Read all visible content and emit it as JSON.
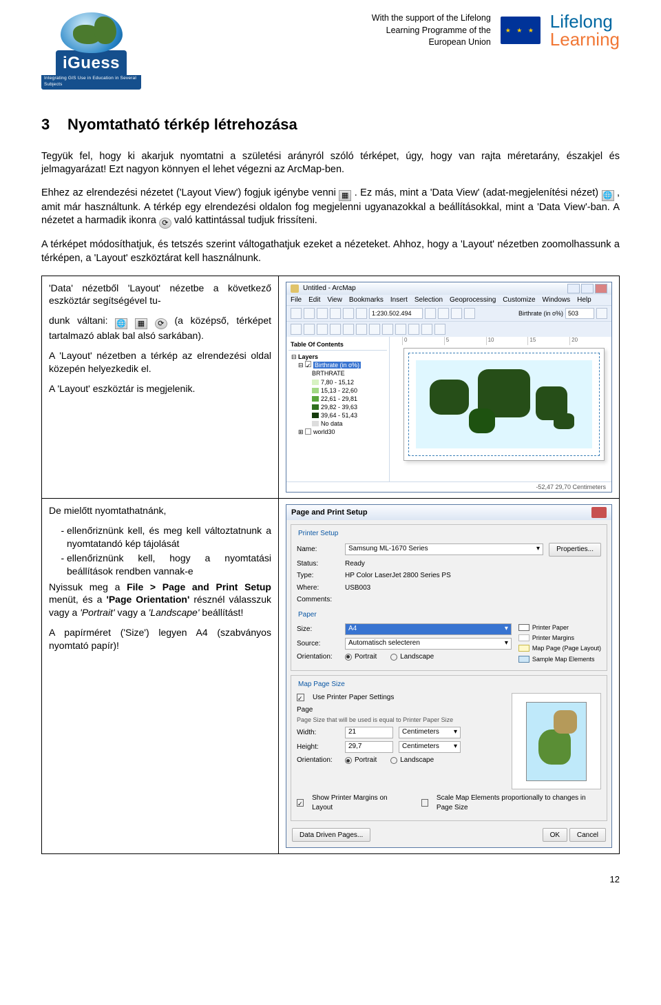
{
  "header": {
    "brand": "iGuess",
    "brand_tagline": "Integrating GIS Use in Education in Several Subjects",
    "support_line1": "With the support of the Lifelong",
    "support_line2": "Learning Programme of the",
    "support_line3": "European Union",
    "eu_stars": "★",
    "ll_lifelong": "Lifelong",
    "ll_learning": "Learning"
  },
  "h1_num": "3",
  "h1_text": "Nyomtatható térkép létrehozása",
  "p1": "Tegyük fel, hogy ki akarjuk nyomtatni a születési arányról szóló térképet, úgy, hogy van rajta méretarány, északjel és jelmagyarázat! Ezt nagyon könnyen el lehet végezni az ArcMap-ben.",
  "p2a": "Ehhez az elrendezési nézetet ('Layout View') fogjuk igénybe venni ",
  "p2b": ". Ez más, mint a 'Data View' (adat-megjelenítési nézet) ",
  "p2c": ", amit már használtunk. A térkép egy elrendezési oldalon fog megjelenni ugyanazokkal a beállításokkal, mint a 'Data View'-ban. A nézetet a harmadik ikonra ",
  "p2d": " való kattintással tudjuk frissíteni.",
  "p3": "A térképet módosíthatjuk, és tetszés szerint váltogathatjuk ezeket a nézeteket. Ahhoz, hogy a 'Layout' nézetben zoomolhassunk a térképen, a 'Layout' eszköztárat kell használnunk.",
  "cell1_a": "'Data' nézetből 'Layout' nézetbe a következő eszköztár segítségével tu-",
  "cell1_b": "dunk váltani: ",
  "cell1_c": " (a középső, térképet tartalmazó ablak bal alsó sarkában).",
  "cell1_d": "A 'Layout' nézetben a térkép az elrendezési oldal közepén helyezkedik el.",
  "cell1_e": "A 'Layout' eszköztár is megjelenik.",
  "cell2_a": "De mielőtt nyomtathatnánk,",
  "cell2_li1": "ellenőriznünk kell, és meg kell változtatnunk a nyomtatandó kép tájolását",
  "cell2_li2": "ellenőriznünk kell, hogy a nyomtatási beállítások rendben vannak-e",
  "cell2_b_pre": "Nyissuk meg a ",
  "cell2_b_bold1": "File > Page and Print Setup",
  "cell2_b_mid": " menüt, és a ",
  "cell2_b_bold2": "'Page Orientation'",
  "cell2_b_post": " résznél válasszuk vagy a ",
  "cell2_b_it1": "'Portrait'",
  "cell2_b_or": " vagy a ",
  "cell2_b_it2": "'Landscape'",
  "cell2_b_end": " beállítást!",
  "cell2_c": "A papírméret ('Size') legyen A4 (szabványos nyomtató papír)!",
  "arcmap": {
    "title": "Untitled - ArcMap",
    "menu": [
      "File",
      "Edit",
      "View",
      "Bookmarks",
      "Insert",
      "Selection",
      "Geoprocessing",
      "Customize",
      "Windows",
      "Help"
    ],
    "scale": "1:230.502.494",
    "stat_label": "Birthrate (in o%)",
    "stat_value": "503",
    "toc_title": "Table Of Contents",
    "layers": "Layers",
    "layer_src": "Birthrate (in o%)",
    "field": "BRTHRATE",
    "classes": [
      {
        "label": "7,80 - 15,12",
        "color": "#d7f2c2"
      },
      {
        "label": "15,13 - 22,60",
        "color": "#a2d884"
      },
      {
        "label": "22,61 - 29,81",
        "color": "#5aa63c"
      },
      {
        "label": "29,82 - 39,63",
        "color": "#2f6f1e"
      },
      {
        "label": "39,64 - 51,43",
        "color": "#163b0c"
      }
    ],
    "nodata": "No data",
    "world30": "world30",
    "ruler": [
      "0",
      "5",
      "10",
      "15",
      "20"
    ],
    "status": "-52,47 29,70 Centimeters"
  },
  "dlg": {
    "title": "Page and Print Setup",
    "sec_printer": "Printer Setup",
    "name": "Name:",
    "name_val": "Samsung ML-1670 Series",
    "props": "Properties...",
    "status": "Status:",
    "status_val": "Ready",
    "type": "Type:",
    "type_val": "HP Color LaserJet 2800 Series PS",
    "where": "Where:",
    "where_val": "USB003",
    "comments": "Comments:",
    "sec_paper": "Paper",
    "size": "Size:",
    "size_val": "A4",
    "source": "Source:",
    "source_val": "Automatisch selecteren",
    "orientation": "Orientation:",
    "portrait": "Portrait",
    "landscape": "Landscape",
    "legend": [
      {
        "label": "Printer Paper",
        "color": "#ffffff",
        "border": "#666"
      },
      {
        "label": "Printer Margins",
        "color": "#ffffff",
        "border": "#bbb"
      },
      {
        "label": "Map Page (Page Layout)",
        "color": "#fff9c9",
        "border": "#c9b94a"
      },
      {
        "label": "Sample Map Elements",
        "color": "#cde6f6",
        "border": "#5a86ab"
      }
    ],
    "sec_mapsize": "Map Page Size",
    "useprinter": "Use Printer Paper Settings",
    "page": "Page",
    "pagesize_note": "Page Size that will be used is equal to Printer Paper Size",
    "width": "Width:",
    "width_val": "21",
    "height": "Height:",
    "height_val": "29,7",
    "unit": "Centimeters",
    "showmargins": "Show Printer Margins on Layout",
    "scaleelems": "Scale Map Elements proportionally to changes in Page Size",
    "ddp": "Data Driven Pages...",
    "ok": "OK",
    "cancel": "Cancel"
  },
  "page_number": "12"
}
